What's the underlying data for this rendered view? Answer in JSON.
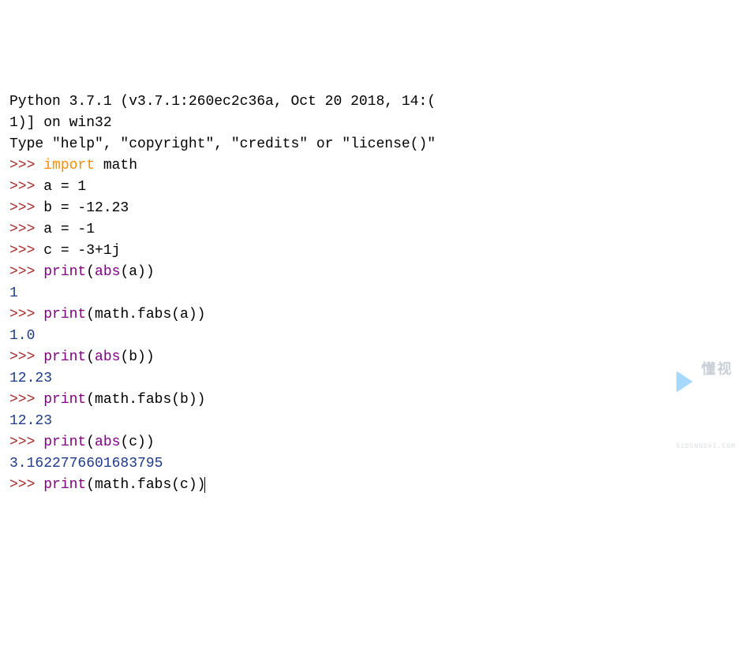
{
  "header": {
    "line1": "Python 3.7.1 (v3.7.1:260ec2c36a, Oct 20 2018, 14:(",
    "line2": "1)] on win32",
    "line3": "Type \"help\", \"copyright\", \"credits\" or \"license()\""
  },
  "prompt": ">>> ",
  "lines": [
    {
      "type": "input",
      "parts": [
        {
          "cls": "keyword",
          "text": "import"
        },
        {
          "cls": "plain",
          "text": " math"
        }
      ]
    },
    {
      "type": "input",
      "parts": [
        {
          "cls": "plain",
          "text": "a = 1"
        }
      ]
    },
    {
      "type": "input",
      "parts": [
        {
          "cls": "plain",
          "text": "b = -12.23"
        }
      ]
    },
    {
      "type": "input",
      "parts": [
        {
          "cls": "plain",
          "text": "a = -1"
        }
      ]
    },
    {
      "type": "input",
      "parts": [
        {
          "cls": "plain",
          "text": "c = -3+1j"
        }
      ]
    },
    {
      "type": "input",
      "parts": [
        {
          "cls": "builtin",
          "text": "print"
        },
        {
          "cls": "plain",
          "text": "("
        },
        {
          "cls": "builtin",
          "text": "abs"
        },
        {
          "cls": "plain",
          "text": "(a))"
        }
      ]
    },
    {
      "type": "output",
      "text": "1"
    },
    {
      "type": "input",
      "parts": [
        {
          "cls": "builtin",
          "text": "print"
        },
        {
          "cls": "plain",
          "text": "(math.fabs(a))"
        }
      ]
    },
    {
      "type": "output",
      "text": "1.0"
    },
    {
      "type": "input",
      "parts": [
        {
          "cls": "builtin",
          "text": "print"
        },
        {
          "cls": "plain",
          "text": "("
        },
        {
          "cls": "builtin",
          "text": "abs"
        },
        {
          "cls": "plain",
          "text": "(b))"
        }
      ]
    },
    {
      "type": "output",
      "text": "12.23"
    },
    {
      "type": "input",
      "parts": [
        {
          "cls": "builtin",
          "text": "print"
        },
        {
          "cls": "plain",
          "text": "(math.fabs(b))"
        }
      ]
    },
    {
      "type": "output",
      "text": "12.23"
    },
    {
      "type": "input",
      "parts": [
        {
          "cls": "builtin",
          "text": "print"
        },
        {
          "cls": "plain",
          "text": "("
        },
        {
          "cls": "builtin",
          "text": "abs"
        },
        {
          "cls": "plain",
          "text": "(c))"
        }
      ]
    },
    {
      "type": "output",
      "text": "3.1622776601683795"
    },
    {
      "type": "input_cursor",
      "parts": [
        {
          "cls": "builtin",
          "text": "print"
        },
        {
          "cls": "plain",
          "text": "(math.fabs(c))"
        }
      ]
    }
  ],
  "watermark": {
    "text": "懂视",
    "sub": "51DONGSHI.COM"
  }
}
